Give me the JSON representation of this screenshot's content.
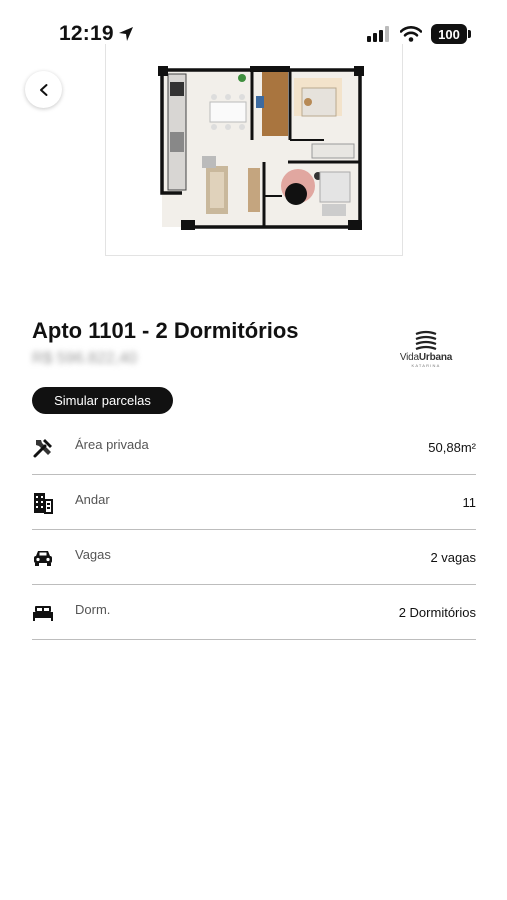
{
  "status_bar": {
    "time": "12:19",
    "battery": "100",
    "icons": [
      "location-arrow-icon",
      "cellular-signal-icon",
      "wifi-icon",
      "battery-icon"
    ]
  },
  "back_button": {
    "icon": "chevron-left-icon"
  },
  "floor_plan": {
    "alt": "floor-plan-image"
  },
  "unit": {
    "title": "Apto 1101 - 2 Dormitórios",
    "price": "R$ 596.822,40"
  },
  "logo": {
    "text_regular": "Vida",
    "text_bold": "Urbana",
    "subtext": "KATARINA"
  },
  "simulate_button": {
    "label": "Simular parcelas"
  },
  "specs": [
    {
      "icon": "tools-icon",
      "label": "Área privada",
      "value": "50,88m²"
    },
    {
      "icon": "building-icon",
      "label": "Andar",
      "value": "11"
    },
    {
      "icon": "car-icon",
      "label": "Vagas",
      "value": "2 vagas"
    },
    {
      "icon": "bed-icon",
      "label": "Dorm.",
      "value": "2 Dormitórios"
    }
  ],
  "colors": {
    "primary": "#111111",
    "divider": "#bdbdbd",
    "label": "#555555"
  }
}
